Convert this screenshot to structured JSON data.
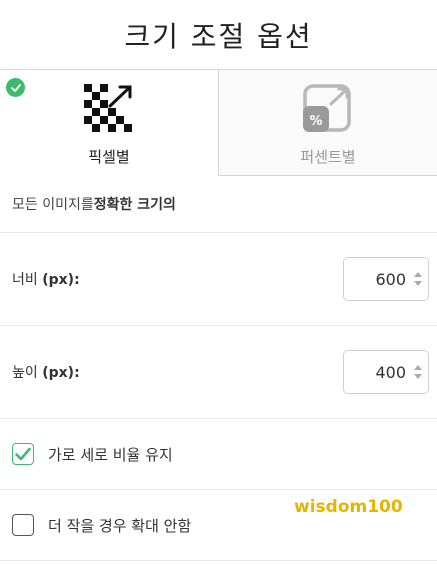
{
  "header": {
    "title": "크기 조절 옵션"
  },
  "tabs": [
    {
      "label": "픽셀별",
      "icon": "pixel-resize-icon",
      "active": true
    },
    {
      "label": "퍼센트별",
      "icon": "percent-resize-icon",
      "active": false
    }
  ],
  "description": {
    "prefix": "모든 이미지를 ",
    "emphasis": "정확한 크기의"
  },
  "width_field": {
    "label": "너비",
    "unit": "(px):",
    "value": "600"
  },
  "height_field": {
    "label": "높이",
    "unit": "(px):",
    "value": "400"
  },
  "options": [
    {
      "label": "가로 세로 비율 유지",
      "checked": true
    },
    {
      "label": "더 작을 경우 확대 안함",
      "checked": false
    }
  ],
  "watermark": "wisdom100",
  "colors": {
    "accent_green": "#3cba6e",
    "watermark": "#e7b400"
  }
}
